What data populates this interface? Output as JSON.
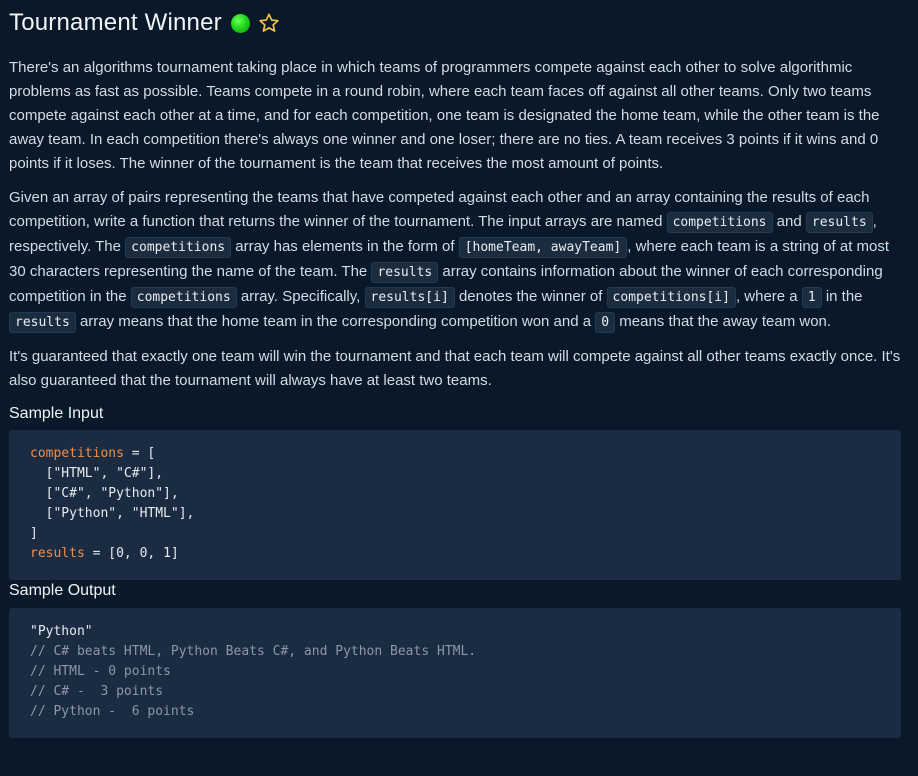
{
  "problem": {
    "title": "Tournament Winner",
    "status_color": "#22d41d",
    "star_icon": "star-outline-icon"
  },
  "description": {
    "p1": "There's an algorithms tournament taking place in which teams of programmers compete against each other to solve algorithmic problems as fast as possible. Teams compete in a round robin, where each team faces off against all other teams. Only two teams compete against each other at a time, and for each competition, one team is designated the home team, while the other team is the away team. In each competition there's always one winner and one loser; there are no ties. A team receives 3 points if it wins and 0 points if it loses. The winner of the tournament is the team that receives the most amount of points.",
    "p2": {
      "t1": "Given an array of pairs representing the teams that have competed against each other and an array containing the results of each competition, write a function that returns the winner of the tournament. The input arrays are named ",
      "c1": "competitions",
      "t2": " and ",
      "c2": "results",
      "t3": ", respectively. The ",
      "c3": "competitions",
      "t4": " array has elements in the form of ",
      "c4": "[homeTeam, awayTeam]",
      "t5": ", where each team is a string of at most 30 characters representing the name of the team. The ",
      "c5": "results",
      "t6": " array contains information about the winner of each corresponding competition in the ",
      "c6": "competitions",
      "t7": " array. Specifically, ",
      "c7": "results[i]",
      "t8": " denotes the winner of ",
      "c8": "competitions[i]",
      "t9": ", where a ",
      "c9": "1",
      "t10": " in the ",
      "c10": "results",
      "t11": " array means that the home team in the corresponding competition won and a ",
      "c11": "0",
      "t12": " means that the away team won."
    },
    "p3": "It's guaranteed that exactly one team will win the tournament and that each team will compete against all other teams exactly once. It's also guaranteed that the tournament will always have at least two teams."
  },
  "sample_input": {
    "label": "Sample Input",
    "line1_var": "competitions",
    "line1_rest": " = [",
    "line2": "  [\"HTML\", \"C#\"],",
    "line3": "  [\"C#\", \"Python\"],",
    "line4": "  [\"Python\", \"HTML\"],",
    "line5": "]",
    "line6_var": "results",
    "line6_rest": " = [0, 0, 1]"
  },
  "sample_output": {
    "label": "Sample Output",
    "line1": "\"Python\"",
    "line2": "// C# beats HTML, Python Beats C#, and Python Beats HTML.",
    "line3": "// HTML - 0 points",
    "line4": "// C# -  3 points",
    "line5": "// Python -  6 points"
  }
}
